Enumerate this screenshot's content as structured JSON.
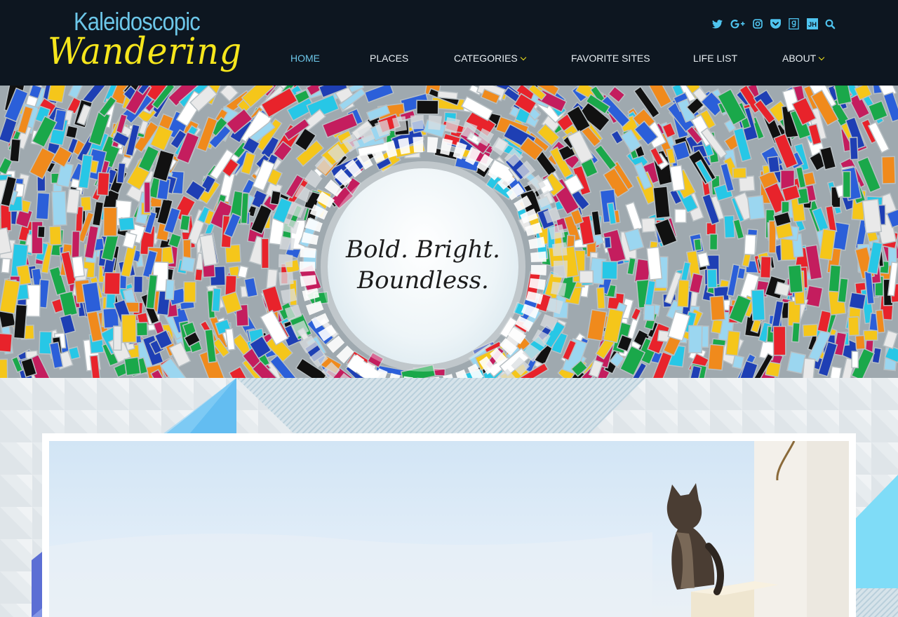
{
  "brand": {
    "title_line1": "Kaleidoscopic",
    "title_line2": "Wandering",
    "colors": {
      "header_bg": "#0d1620",
      "accent_blue": "#6cc6e8",
      "accent_yellow": "#f6e61c"
    }
  },
  "social_icons": [
    "twitter-icon",
    "google-plus-icon",
    "instagram-icon",
    "pocket-icon",
    "goodreads-icon",
    "jh-icon",
    "search-icon"
  ],
  "social_labels": {
    "jh": "JH"
  },
  "nav": {
    "items": [
      {
        "label": "HOME",
        "active": true,
        "dropdown": false
      },
      {
        "label": "PLACES",
        "active": false,
        "dropdown": false
      },
      {
        "label": "CATEGORIES",
        "active": false,
        "dropdown": true
      },
      {
        "label": "FAVORITE SITES",
        "active": false,
        "dropdown": false
      },
      {
        "label": "LIFE LIST",
        "active": false,
        "dropdown": false
      },
      {
        "label": "ABOUT",
        "active": false,
        "dropdown": true
      }
    ]
  },
  "hero": {
    "line1": "Bold. Bright.",
    "line2": "Boundless."
  }
}
